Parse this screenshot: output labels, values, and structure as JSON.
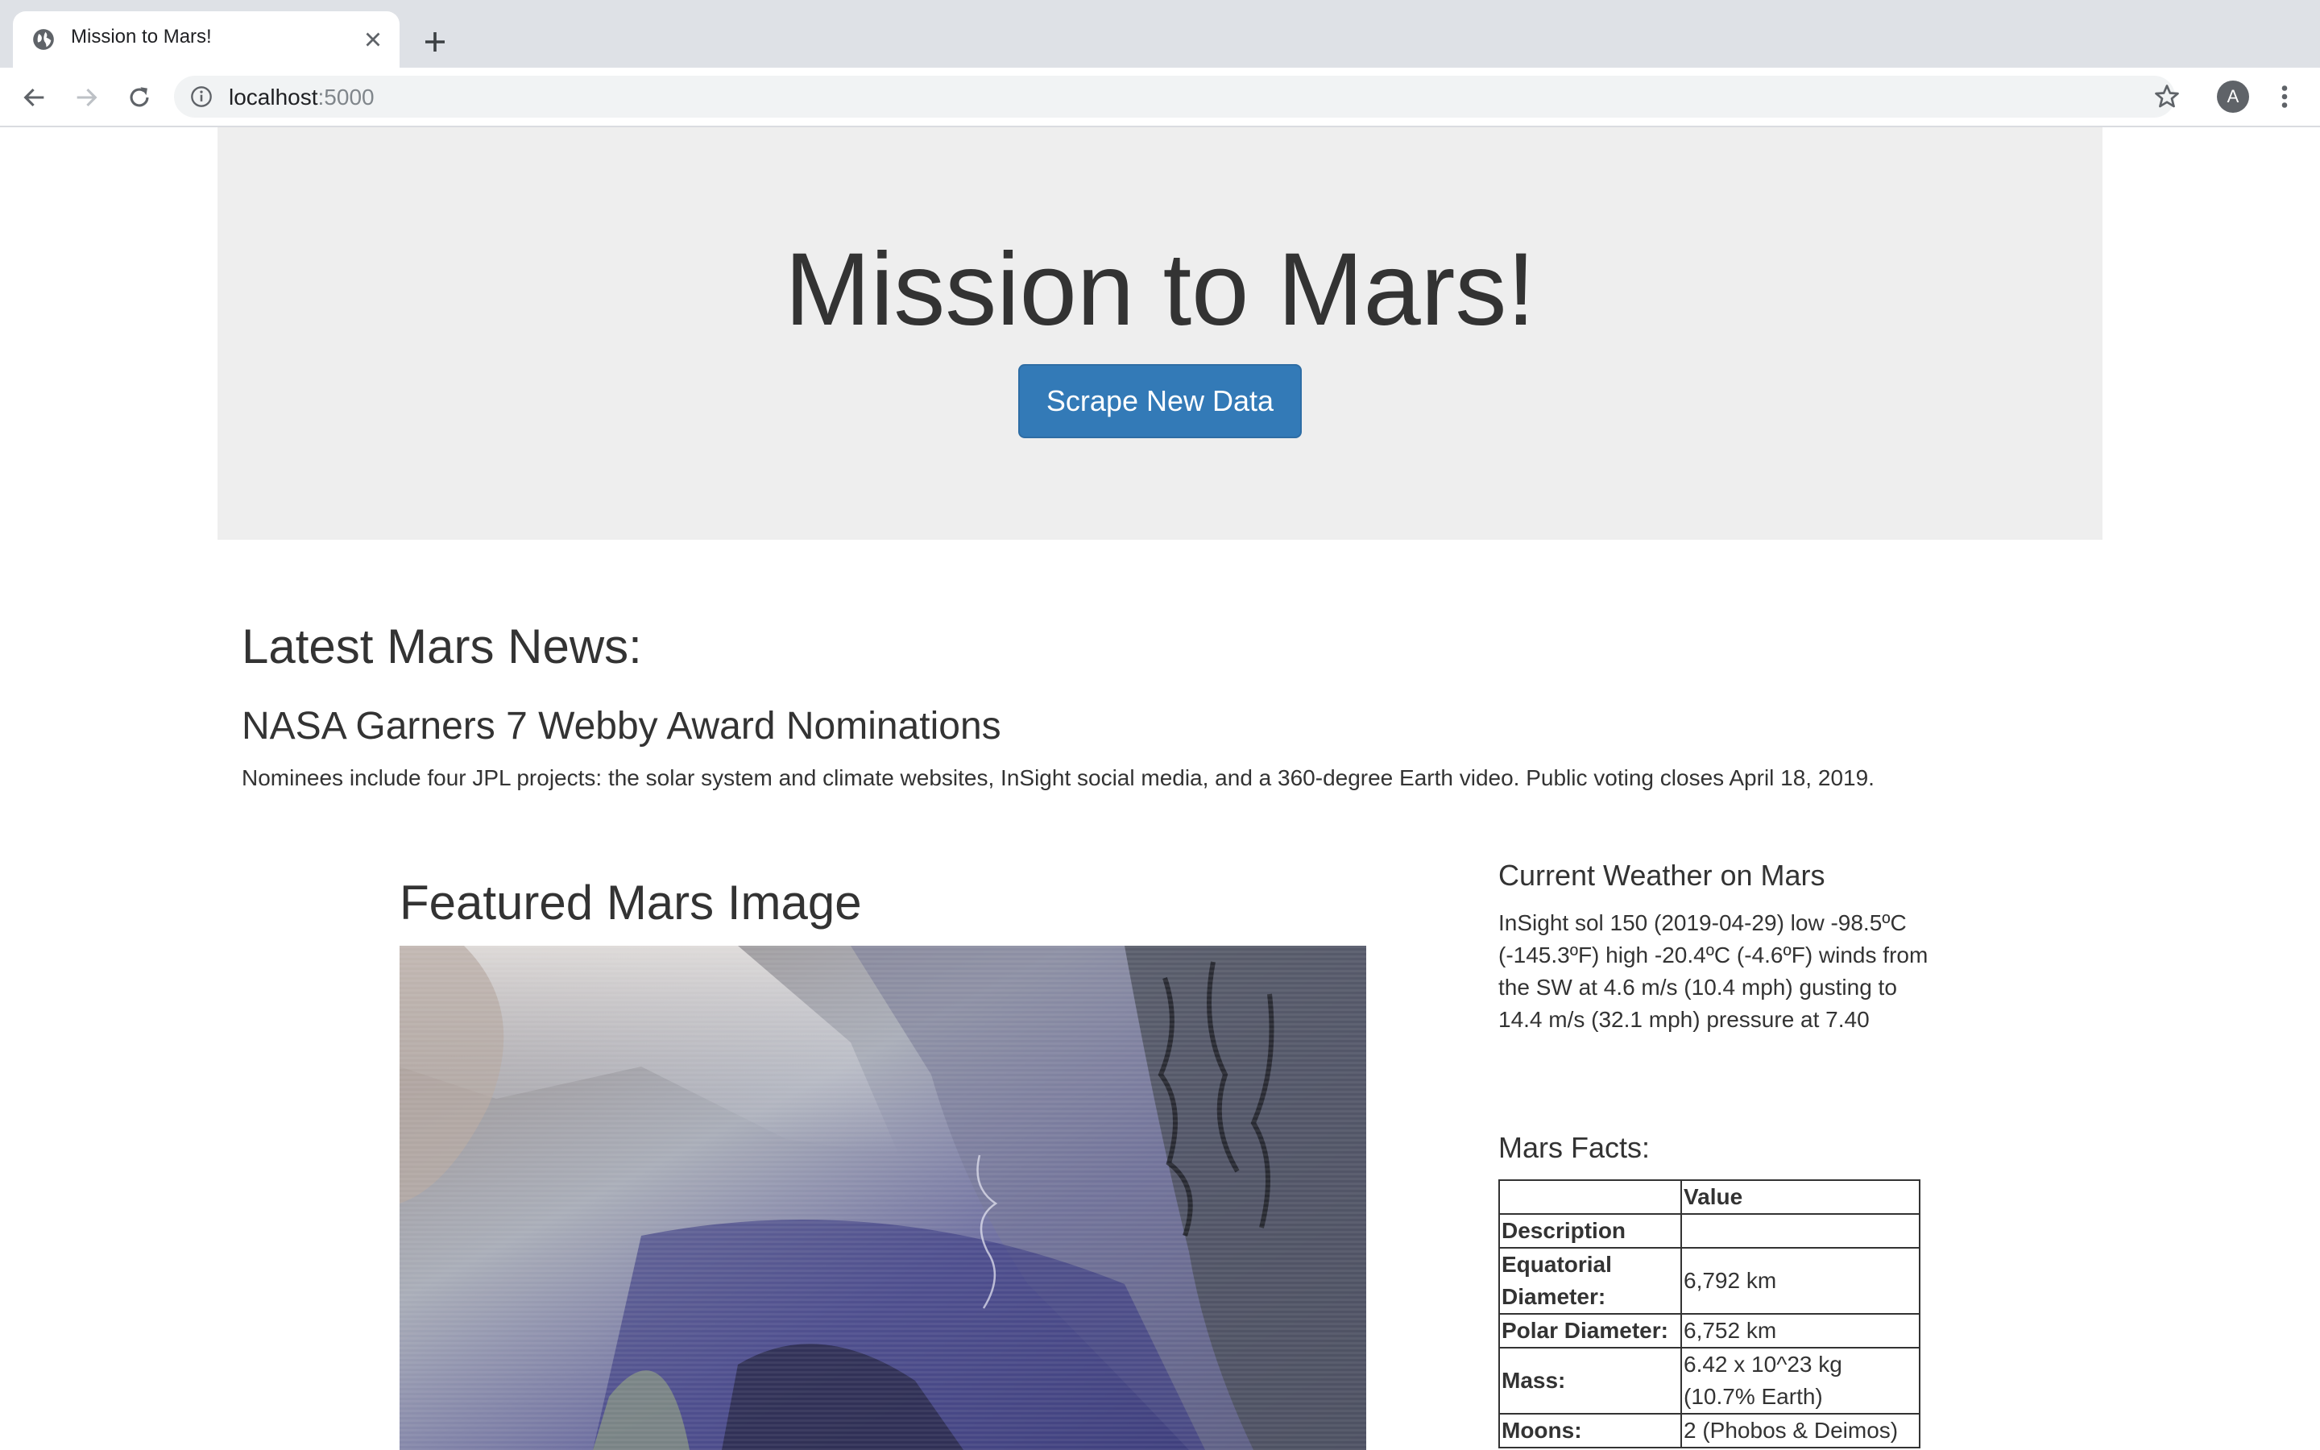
{
  "browser": {
    "tab_title": "Mission to Mars!",
    "url_host": "localhost",
    "url_port": ":5000",
    "avatar_letter": "A"
  },
  "jumbotron": {
    "title": "Mission to Mars!",
    "button_label": "Scrape New Data"
  },
  "news": {
    "heading": "Latest Mars News:",
    "title": "NASA Garners 7 Webby Award Nominations",
    "paragraph": "Nominees include four JPL projects: the solar system and climate websites, InSight social media, and a 360-degree Earth video. Public voting closes April 18, 2019."
  },
  "featured": {
    "heading": "Featured Mars Image"
  },
  "weather": {
    "heading": "Current Weather on Mars",
    "text": "InSight sol 150 (2019-04-29) low -98.5ºC (-145.3ºF) high -20.4ºC (-4.6ºF) winds from the SW at 4.6 m/s (10.4 mph) gusting to 14.4 m/s (32.1 mph) pressure at 7.40"
  },
  "facts": {
    "heading": "Mars Facts:",
    "header": [
      "",
      "Value"
    ],
    "index_label": "Description",
    "rows": [
      {
        "key": "Equatorial Diameter:",
        "value": "6,792 km"
      },
      {
        "key": "Polar Diameter:",
        "value": "6,752 km"
      },
      {
        "key": "Mass:",
        "value": "6.42 x 10^23 kg (10.7% Earth)"
      },
      {
        "key": "Moons:",
        "value": "2 (Phobos & Deimos)"
      }
    ]
  }
}
